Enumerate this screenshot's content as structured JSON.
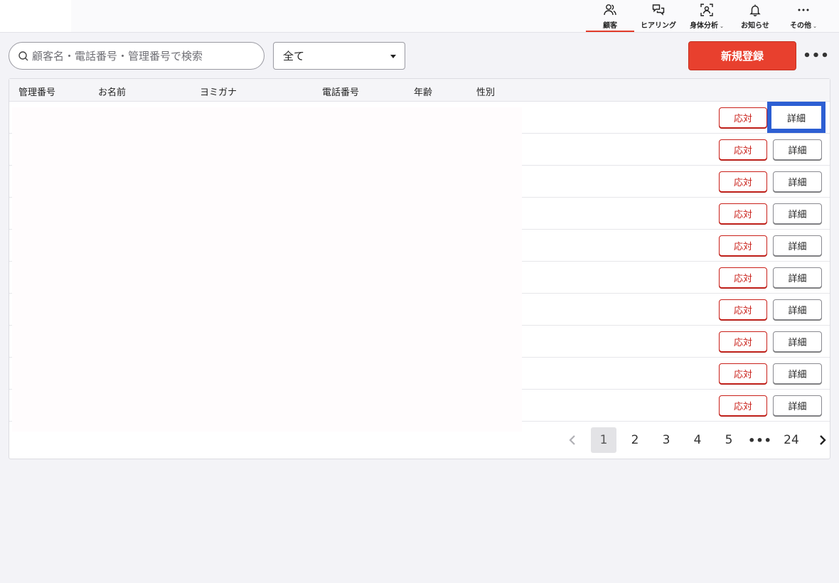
{
  "nav": {
    "items": [
      {
        "label": "顧客",
        "icon": "users-icon",
        "active": true,
        "caret": ""
      },
      {
        "label": "ヒアリング",
        "icon": "chat-bubbles-icon",
        "active": false,
        "caret": ""
      },
      {
        "label": "身体分析",
        "icon": "body-scan-icon",
        "active": false,
        "caret": "⌄"
      },
      {
        "label": "お知らせ",
        "icon": "bell-icon",
        "active": false,
        "caret": ""
      },
      {
        "label": "その他",
        "icon": "more-dots-icon",
        "active": false,
        "caret": "⌄"
      }
    ]
  },
  "toolbar": {
    "search_placeholder": "顧客名・電話番号・管理番号で検索",
    "search_value": "",
    "filter_selected": "全て",
    "register_label": "新規登録",
    "more_label": "•••"
  },
  "table": {
    "headers": [
      "管理番号",
      "お名前",
      "ヨミガナ",
      "電話番号",
      "年齢",
      "性別"
    ],
    "respond_label": "応対",
    "detail_label": "詳細",
    "row_count": 10
  },
  "pagination": {
    "pages": [
      "1",
      "2",
      "3",
      "4",
      "5"
    ],
    "ellipsis": "•••",
    "last_page": "24",
    "current_page": "1"
  },
  "colors": {
    "accent": "#e8402e",
    "respond_red": "#c9201a",
    "focus_blue": "#2d5fd3"
  }
}
